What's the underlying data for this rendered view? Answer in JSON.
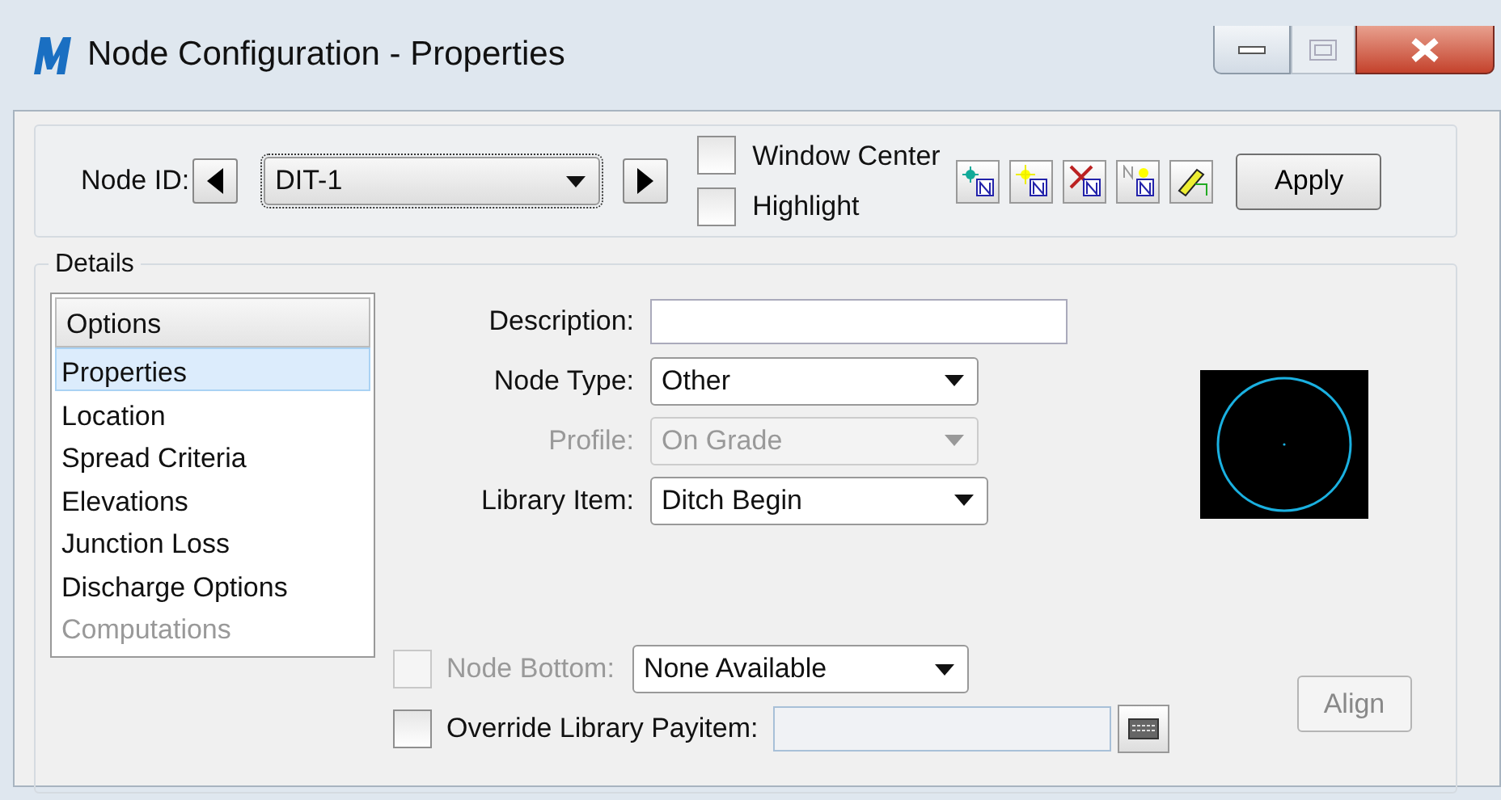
{
  "window": {
    "title": "Node Configuration - Properties"
  },
  "toolbar": {
    "node_id_label": "Node ID:",
    "node_id": "DIT-1",
    "checkboxes": [
      {
        "label": "Window Center",
        "checked": false
      },
      {
        "label": "Highlight",
        "checked": false
      }
    ],
    "apply_button": "Apply"
  },
  "details": {
    "title": "Details",
    "options_header": "Options",
    "options": [
      {
        "label": "Properties",
        "selected": true,
        "disabled": false
      },
      {
        "label": "Location",
        "selected": false,
        "disabled": false
      },
      {
        "label": "Spread Criteria",
        "selected": false,
        "disabled": false
      },
      {
        "label": "Elevations",
        "selected": false,
        "disabled": false
      },
      {
        "label": "Junction Loss",
        "selected": false,
        "disabled": false
      },
      {
        "label": "Discharge Options",
        "selected": false,
        "disabled": false
      },
      {
        "label": "Computations",
        "selected": false,
        "disabled": true
      }
    ],
    "fields": [
      {
        "kind": "text",
        "label": "Description:",
        "disabled": false
      },
      {
        "kind": "select",
        "label": "Node Type:",
        "value": "Other",
        "disabled": false
      },
      {
        "kind": "select",
        "label": "Profile:",
        "value": "On Grade",
        "disabled": true
      },
      {
        "kind": "select",
        "label": "Library Item:",
        "value": "Ditch Begin",
        "disabled": false
      }
    ],
    "node_bottom": {
      "label": "Node Bottom:",
      "checked": false,
      "disabled": true,
      "value": "None Available"
    },
    "override": {
      "label": "Override Library Payitem:",
      "checked": false
    },
    "align_button": {
      "label": "Align",
      "disabled": true
    }
  }
}
